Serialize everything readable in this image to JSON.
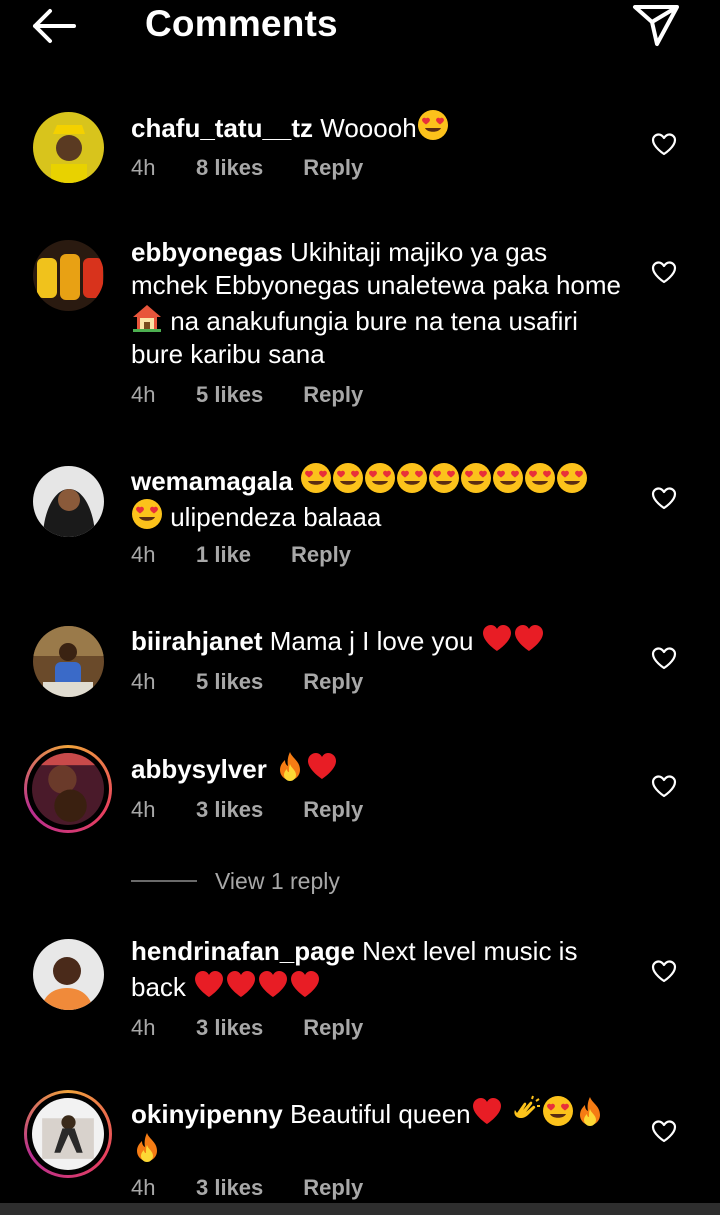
{
  "header": {
    "title": "Comments"
  },
  "comments": [
    {
      "username": "chafu_tatu__tz",
      "body": "Wooooh",
      "emojis": [
        "heart-eyes"
      ],
      "age": "4h",
      "likes": "8 likes",
      "reply": "Reply"
    },
    {
      "username": "ebbyonegas",
      "body": "Ukihitaji majiko ya gas mchek Ebbyonegas  unaletewa paka home",
      "body2": " na anakufungia bure na tena usafiri bure karibu sana",
      "emojis": [
        "house"
      ],
      "age": "4h",
      "likes": "5 likes",
      "reply": "Reply"
    },
    {
      "username": "wemamagala",
      "body2": " ulipendeza balaaa",
      "emojis": [
        "heart-eyes",
        "heart-eyes",
        "heart-eyes",
        "heart-eyes",
        "heart-eyes",
        "heart-eyes",
        "heart-eyes",
        "heart-eyes",
        "heart-eyes",
        "heart-eyes"
      ],
      "age": "4h",
      "likes": "1 like",
      "reply": "Reply"
    },
    {
      "username": "biirahjanet",
      "body": "Mama j I love you ",
      "emojis": [
        "red-heart",
        "red-heart"
      ],
      "age": "4h",
      "likes": "5 likes",
      "reply": "Reply"
    },
    {
      "username": "abbysylver",
      "body": "",
      "emojis": [
        "fire",
        "red-heart"
      ],
      "age": "4h",
      "likes": "3 likes",
      "reply": "Reply",
      "view_replies": "View 1 reply"
    },
    {
      "username": "hendrinafan_page",
      "body": "Next level music is back ",
      "emojis": [
        "red-heart",
        "red-heart",
        "red-heart",
        "red-heart"
      ],
      "age": "4h",
      "likes": "3 likes",
      "reply": "Reply"
    },
    {
      "username": "okinyipenny",
      "body": "Beautiful queen",
      "emojis": [
        "red-heart",
        "clapping-hands",
        "heart-eyes",
        "fire",
        "fire"
      ],
      "age": "4h",
      "likes": "3 likes",
      "reply": "Reply"
    }
  ],
  "colors": {
    "background": "#000000",
    "meta": "#a8a8a8",
    "story_ring": [
      "#f0a33b",
      "#e8405e",
      "#b72e8f"
    ]
  }
}
